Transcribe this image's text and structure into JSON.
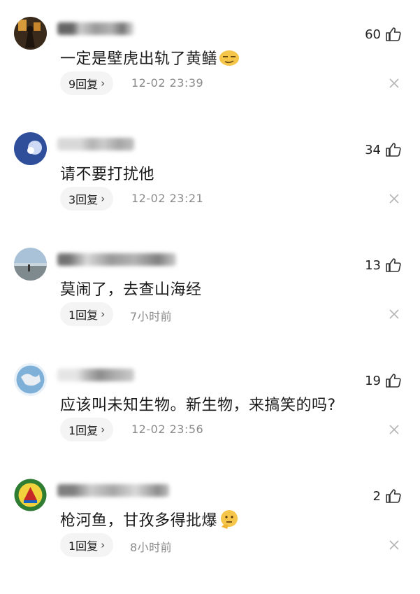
{
  "comments": [
    {
      "likes": "60",
      "text": "一定是壁虎出轨了黄鳝",
      "emoji": "smug-face-emoji",
      "replies": "9回复",
      "time": "12-02 23:39"
    },
    {
      "likes": "34",
      "text": "请不要打扰他",
      "emoji": "",
      "replies": "3回复",
      "time": "12-02 23:21"
    },
    {
      "likes": "13",
      "text": "莫闹了，去查山海经",
      "emoji": "",
      "replies": "1回复",
      "time": "7小时前"
    },
    {
      "likes": "19",
      "text": "应该叫未知生物。新生物，来搞笑的吗?",
      "emoji": "",
      "replies": "1回复",
      "time": "12-02 23:56"
    },
    {
      "likes": "2",
      "text": "枪河鱼，甘孜多得批爆",
      "emoji": "thinking-face-emoji",
      "replies": "1回复",
      "time": "8小时前"
    }
  ],
  "icons": {
    "like": "thumbs-up-icon",
    "dismiss": "close-icon",
    "reply_chevron": "›"
  },
  "colors": {
    "text": "#1b1b1b",
    "meta": "#8a8a8a",
    "pill_bg": "#f4f4f4"
  }
}
